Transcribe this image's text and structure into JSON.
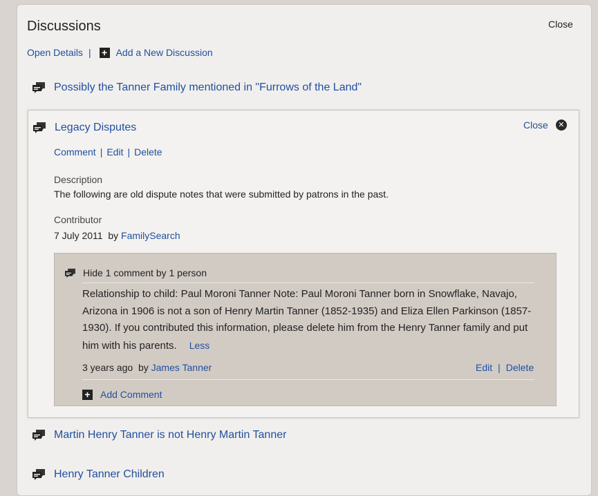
{
  "header": {
    "title": "Discussions",
    "close_label": "Close",
    "open_details": "Open Details",
    "separator": "|",
    "add_discussion": "Add a New Discussion"
  },
  "discussions": [
    "Possibly the Tanner Family mentioned in \"Furrows of the Land\"",
    "Legacy Disputes",
    "Martin Henry Tanner is not Henry Martin Tanner",
    "Henry Tanner Children"
  ],
  "expanded": {
    "close_label": "Close",
    "actions": {
      "comment": "Comment",
      "edit": "Edit",
      "delete": "Delete",
      "separator": "|"
    },
    "description_label": "Description",
    "description_text": "The following are old dispute notes that were submitted by patrons in the past.",
    "contributor_label": "Contributor",
    "contributor_date": "7 July 2011",
    "contributor_by": "by",
    "contributor_name": "FamilySearch"
  },
  "comments": {
    "toggle_label": "Hide 1 comment by 1 person",
    "body": "Relationship to child: Paul Moroni Tanner   Note: Paul Moroni Tanner born in Snowflake, Navajo, Arizona in 1906 is not a son of Henry Martin Tanner (1852-1935) and Eliza Ellen Parkinson (1857-1930). If you contributed this information, please delete him from the Henry Tanner family and put him with his parents.",
    "less_label": "Less",
    "time_ago": "3 years ago",
    "by": "by",
    "author": "James Tanner",
    "edit": "Edit",
    "delete": "Delete",
    "separator": "|",
    "add_comment": "Add Comment"
  },
  "colors": {
    "link": "#1f4f9f",
    "panel": "#f1efed",
    "comment_bg": "#d2cbc4",
    "page_bg": "#d9d4cf"
  },
  "icons": {
    "discussion": "speech-bubbles-icon",
    "add": "plus-square-icon",
    "close": "close-circle-icon"
  }
}
